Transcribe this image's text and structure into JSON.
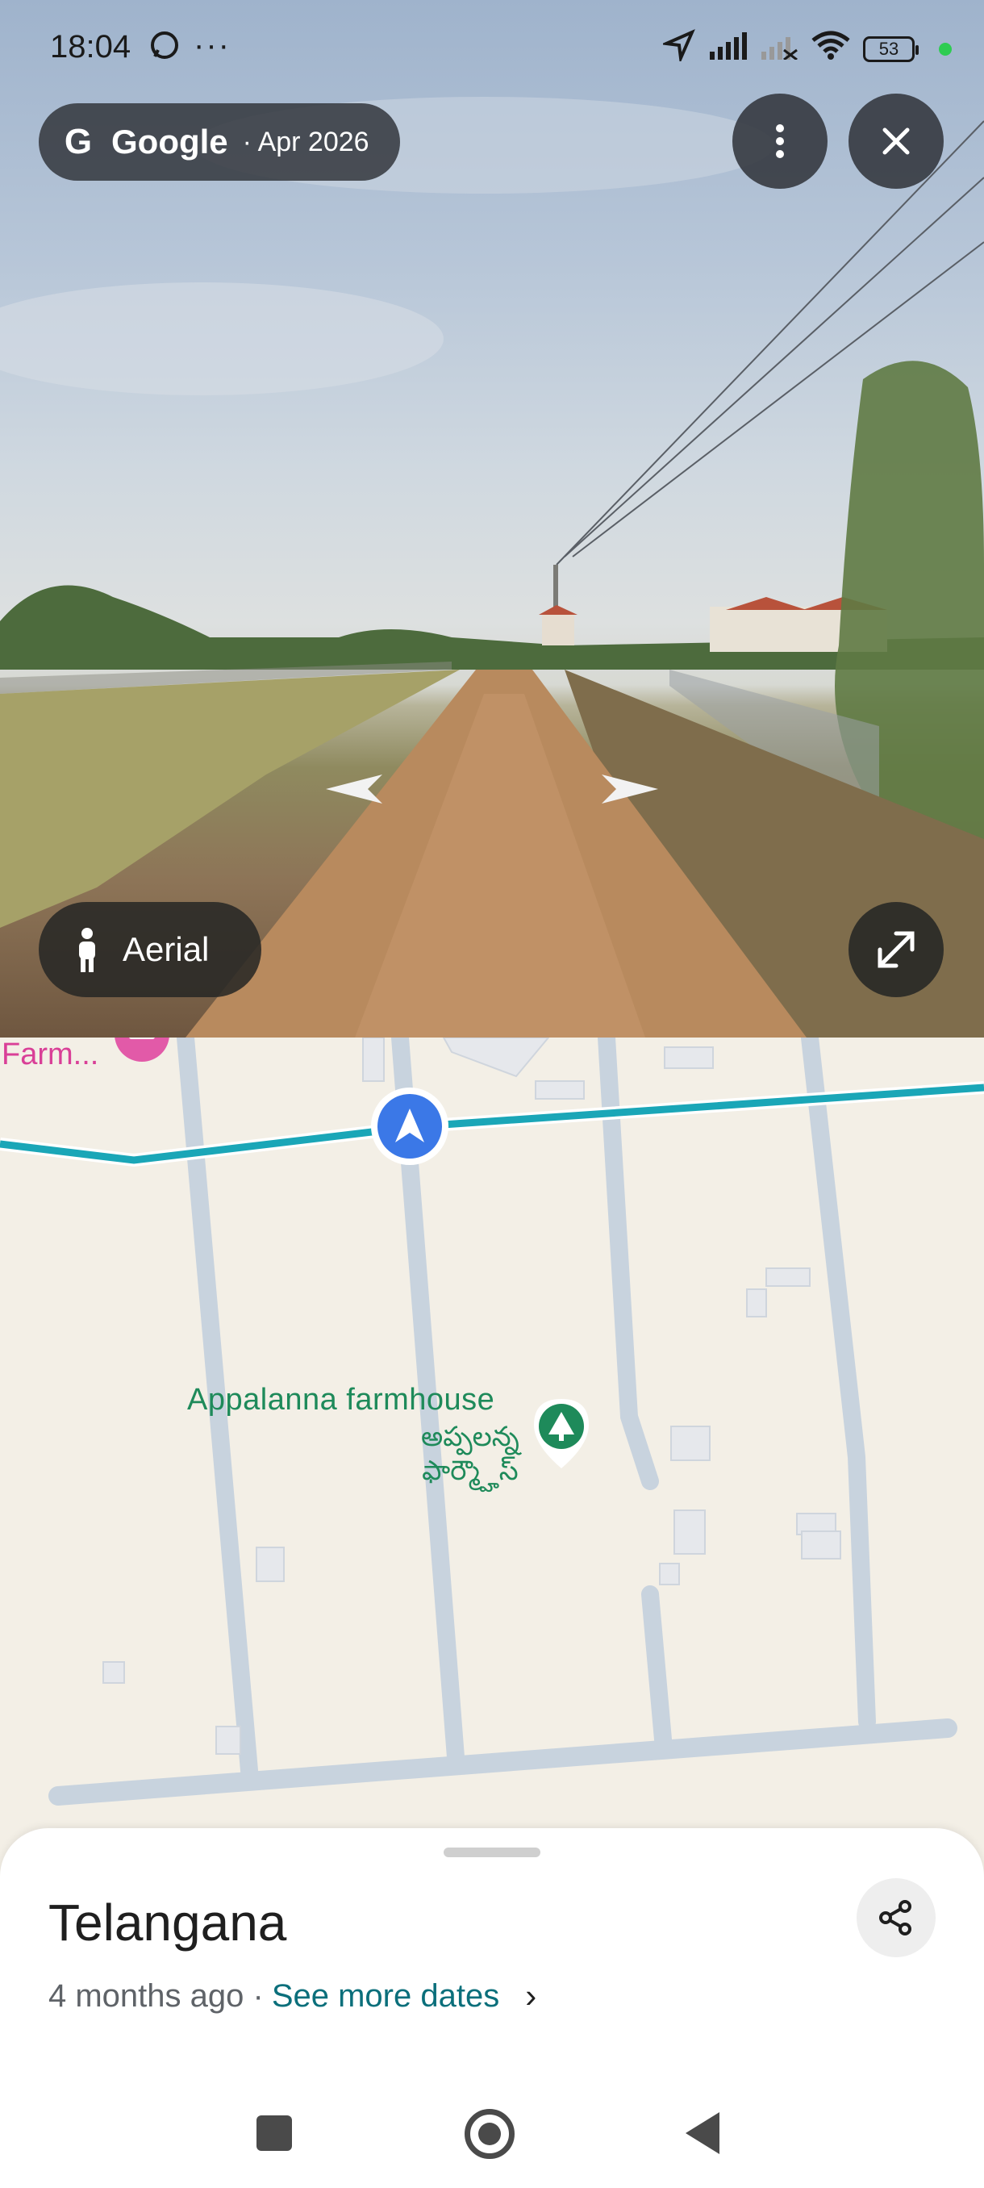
{
  "status_bar": {
    "time": "18:04",
    "overflow": "···",
    "battery": "53",
    "icons": [
      "whatsapp-icon",
      "location-arrow-icon",
      "signal-icon",
      "signal-off-icon",
      "wifi-icon",
      "battery-icon"
    ]
  },
  "street_view": {
    "brand": "Google",
    "capture_date": "· Apr 2026",
    "aerial_label": "Aerial",
    "icons": [
      "google-g-icon",
      "more-vert-icon",
      "close-icon",
      "pegman-icon",
      "expand-icon",
      "nav-arrow-left-icon",
      "nav-arrow-right-icon"
    ]
  },
  "map": {
    "poi_truncated": "Farm...",
    "place_name": "Appalanna farmhouse",
    "place_name_local_line1": "అప్పలన్న",
    "place_name_local_line2": "ఫార్మ్హౌస్",
    "icons": [
      "location-pin-pink-icon",
      "position-marker-icon",
      "tree-pin-icon"
    ],
    "colors": {
      "route": "#1aa6b7",
      "road": "#c8d3de",
      "land": "#f3efe6",
      "poi": "#1e8a5a",
      "marker": "#3b78e7"
    }
  },
  "sheet": {
    "title": "Telangana",
    "when": "4 months ago ·",
    "see_more": "See more dates",
    "chevron": "›",
    "icons": [
      "share-icon",
      "chevron-right-icon"
    ]
  },
  "system_nav": {
    "icons": [
      "recents-square-icon",
      "home-circle-icon",
      "back-triangle-icon"
    ]
  }
}
